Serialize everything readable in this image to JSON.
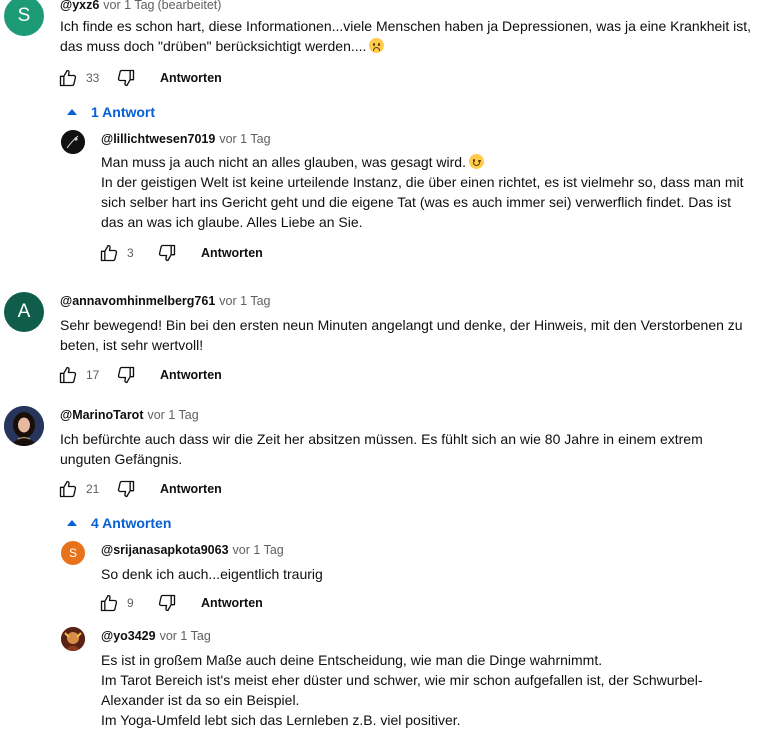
{
  "common": {
    "reply_label": "Antworten"
  },
  "comments": [
    {
      "author": "@yxz6",
      "time": "vor 1 Tag",
      "edited": "(bearbeitet)",
      "avatar_letter": "S",
      "avatar_color": "#1d9b74",
      "lines": [
        "Ich finde es schon hart, diese Informationen...viele Menschen haben ja Depressionen, was ja eine Krankheit ist,",
        "das muss doch \"drüben\" berücksichtigt werden...."
      ],
      "likes": "33",
      "replies_toggle": "1 Antwort",
      "replies": [
        {
          "author": "@lillichtwesen7019",
          "time": "vor 1 Tag",
          "avatar_icon": "dark-figure-avatar",
          "lines": [
            "Man muss ja auch nicht an alles glauben, was gesagt wird.",
            "In der geistigen Welt ist keine urteilende Instanz, die über einen richtet, es ist vielmehr so, dass man mit",
            "sich selber hart ins Gericht geht und die eigene Tat (was es auch immer sei) verwerflich findet. Das ist",
            "das an was ich glaube. Alles Liebe an Sie."
          ],
          "likes": "3"
        }
      ]
    },
    {
      "author": "@annavomhinmelberg761",
      "time": "vor 1 Tag",
      "avatar_letter": "A",
      "avatar_color": "#0f5d4a",
      "lines": [
        "Sehr bewegend! Bin bei den ersten neun Minuten angelangt und denke, der Hinweis, mit den Verstorbenen zu",
        "beten, ist sehr wertvoll!"
      ],
      "likes": "17"
    },
    {
      "author": "@MarinoTarot",
      "time": "vor 1 Tag",
      "avatar_icon": "portrait-photo-avatar",
      "lines": [
        "Ich befürchte auch dass wir die Zeit her absitzen müssen. Es fühlt sich an wie 80 Jahre in einem extrem",
        "unguten Gefängnis."
      ],
      "likes": "21",
      "replies_toggle": "4 Antworten",
      "replies": [
        {
          "author": "@srijanasapkota9063",
          "time": "vor 1 Tag",
          "avatar_letter": "S",
          "avatar_color": "#e8711c",
          "lines": [
            "So denk ich auch...eigentlich traurig"
          ],
          "likes": "9"
        },
        {
          "author": "@yo3429",
          "time": "vor 1 Tag",
          "avatar_icon": "illustrated-avatar",
          "lines": [
            "Es ist in großem Maße auch deine Entscheidung, wie man die Dinge wahrnimmt.",
            "Im Tarot Bereich ist's meist eher düster und schwer, wie mir schon aufgefallen ist, der Schwurbel-",
            "Alexander ist da so ein Beispiel.",
            "Im Yoga-Umfeld lebt sich das Lernleben z.B. viel positiver."
          ]
        }
      ]
    }
  ],
  "colors": {
    "link_blue": "#065fd4",
    "meta_gray": "#606060",
    "text": "#0f0f0f"
  }
}
